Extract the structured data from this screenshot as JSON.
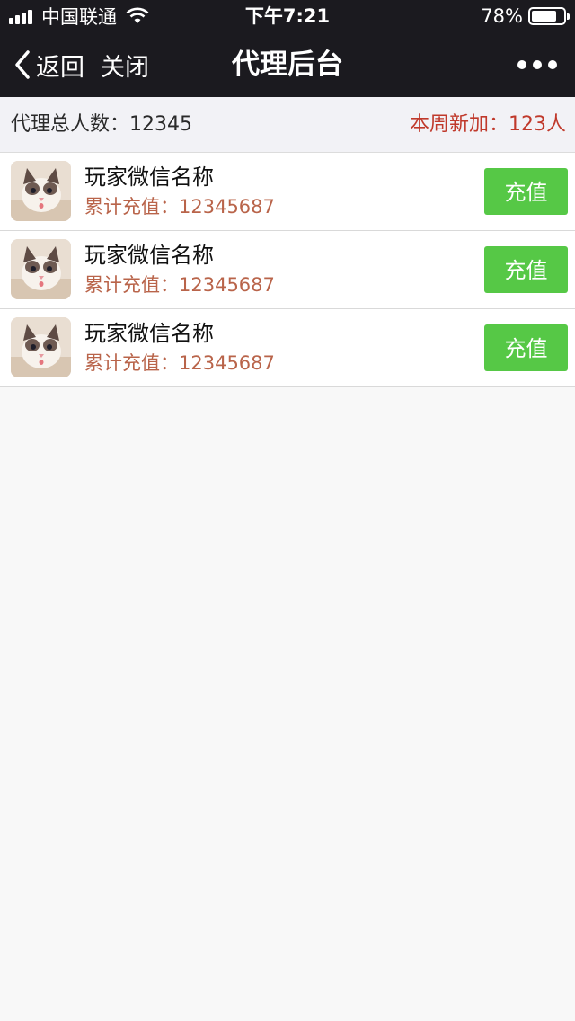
{
  "status_bar": {
    "carrier": "中国联通",
    "time": "下午7:21",
    "battery_percent_text": "78%",
    "battery_level": 0.78
  },
  "nav": {
    "back_label": "返回",
    "close_label": "关闭",
    "title": "代理后台",
    "more_icon": "more-dots-icon"
  },
  "summary": {
    "total_agents": "代理总人数：12345",
    "weekly_new": "本周新加：123人"
  },
  "players": [
    {
      "name": "玩家微信名称",
      "total": "累计充值：12345687",
      "action": "充值"
    },
    {
      "name": "玩家微信名称",
      "total": "累计充值：12345687",
      "action": "充值"
    },
    {
      "name": "玩家微信名称",
      "total": "累计充值：12345687",
      "action": "充值"
    }
  ],
  "colors": {
    "header_bg": "#1b1a1f",
    "summary_bg": "#f2f2f6",
    "page_bg": "#f8f8f8",
    "accent_red": "#c0392b",
    "total_text": "#b9644a",
    "button_green": "#56c846"
  }
}
